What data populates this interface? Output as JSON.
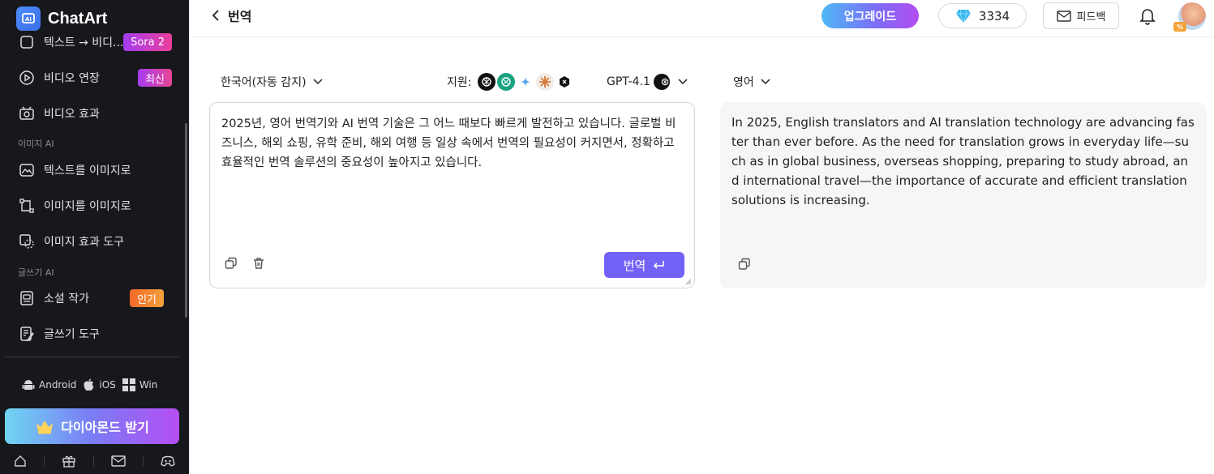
{
  "sidebar": {
    "brand": "ChatArt",
    "items": [
      {
        "label": "텍스트 → 비디...",
        "badge": "Sora 2",
        "icon": "text-to-video-icon"
      },
      {
        "label": "비디오 연장",
        "badge": "최신",
        "icon": "video-extend-icon"
      },
      {
        "label": "비디오 효과",
        "icon": "video-effect-icon"
      },
      {
        "label": "텍스트를 이미지로",
        "icon": "text-to-image-icon"
      },
      {
        "label": "이미지를 이미지로",
        "icon": "image-to-image-icon"
      },
      {
        "label": "이미지 효과 도구",
        "icon": "image-effect-icon"
      },
      {
        "label": "소설 작가",
        "badge": "인기",
        "icon": "novel-writer-icon"
      },
      {
        "label": "글쓰기 도구",
        "icon": "writing-tool-icon"
      }
    ],
    "sections": {
      "image_ai": "이미지 AI",
      "writing_ai": "글쓰기 AI"
    },
    "platforms": [
      "Android",
      "iOS",
      "Win"
    ],
    "diamond_button": "다이아몬드 받기",
    "accent": "#7362f6"
  },
  "header": {
    "title": "번역",
    "upgrade": "업그레이드",
    "credits": "3334",
    "feedback": "피드백"
  },
  "translator": {
    "source_lang": "한국어(자동 감지)",
    "support_label": "지원:",
    "model": "GPT-4.1",
    "target_lang": "영어",
    "source_text": "2025년, 영어 번역기와 AI 번역 기술은 그 어느 때보다 빠르게 발전하고 있습니다. 글로벌 비즈니스, 해외 쇼핑, 유학 준비, 해외 여행 등 일상 속에서 번역의 필요성이 커지면서, 정확하고 효율적인 번역 솔루션의 중요성이 높아지고 있습니다.",
    "translate_button": "번역",
    "target_text": "In 2025, English translators and AI translation technology are advancing faster than ever before. As the need for translation grows in everyday life—such as in global business, overseas shopping, preparing to study abroad, and international travel—the importance of accurate and efficient translation solutions is increasing."
  }
}
